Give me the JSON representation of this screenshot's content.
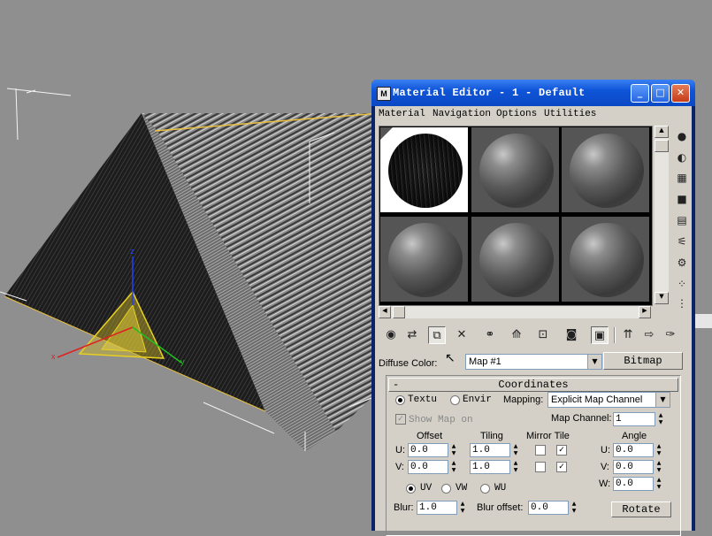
{
  "window": {
    "title": "Material Editor - 1 - Default",
    "min": "_",
    "max": "□",
    "close": "✕"
  },
  "menu": [
    "Material",
    "Navigation",
    "Options",
    "Utilities"
  ],
  "diffuse": {
    "label": "Diffuse Color:",
    "map_value": "Map #1",
    "type_button": "Bitmap"
  },
  "coordinates": {
    "header": "Coordinates",
    "collapse": "-",
    "texture_label": "Textu",
    "environ_label": "Envir",
    "mapping_label": "Mapping:",
    "mapping_value": "Explicit Map Channel",
    "show_map_label": "Show Map on",
    "map_channel_label": "Map Channel:",
    "map_channel_value": "1",
    "offset_label": "Offset",
    "tiling_label": "Tiling",
    "mirror_tile_label": "Mirror Tile",
    "angle_label": "Angle",
    "u_label": "U:",
    "v_label": "V:",
    "w_label": "W:",
    "u_offset": "0.0",
    "v_offset": "0.0",
    "u_tiling": "1.0",
    "v_tiling": "1.0",
    "u_angle": "0.0",
    "v_angle": "0.0",
    "w_angle": "0.0",
    "uv_label": "UV",
    "vw_label": "VW",
    "wu_label": "WU",
    "blur_label": "Blur:",
    "blur_value": "1.0",
    "blur_offset_label": "Blur offset:",
    "blur_offset_value": "0.0",
    "rotate_button": "Rotate"
  },
  "gizmo": {
    "z": "z",
    "x": "x",
    "y": "y"
  },
  "colors": {
    "title_bar": "#0f55d8",
    "panel": "#d4d0c8",
    "viewport": "#8f8f8f"
  }
}
